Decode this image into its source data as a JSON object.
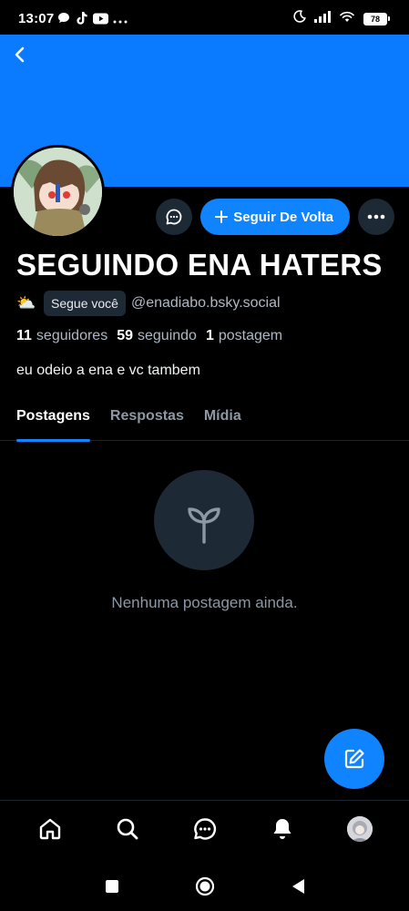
{
  "status_bar": {
    "time": "13:07",
    "battery": "78",
    "left_icons": [
      "chat-bubble-icon",
      "tiktok-icon",
      "youtube-icon",
      "more-dots-icon"
    ],
    "right_icons": [
      "moon-icon",
      "signal-icon",
      "wifi-icon",
      "battery-icon"
    ]
  },
  "profile": {
    "display_name": "SEGUINDO ENA HATERS",
    "handle": "@enadiabo.bsky.social",
    "follows_you_badge": "Segue você",
    "emoji": "⛅",
    "bio": "eu odeio a ena e vc tambem",
    "stats": {
      "followers_count": "11",
      "followers_label": "seguidores",
      "following_count": "59",
      "following_label": "seguindo",
      "posts_count": "1",
      "posts_label": "postagem"
    },
    "banner_color": "#0a7aff"
  },
  "actions": {
    "follow_back_label": "Seguir De Volta",
    "message_icon": "message-icon",
    "more_icon": "more-horizontal-icon"
  },
  "tabs": [
    {
      "label": "Postagens",
      "active": true
    },
    {
      "label": "Respostas",
      "active": false
    },
    {
      "label": "Mídia",
      "active": false
    }
  ],
  "empty_state": {
    "icon": "sprout-icon",
    "text": "Nenhuma postagem ainda."
  },
  "fab": {
    "icon": "compose-icon"
  },
  "bottom_nav": [
    {
      "name": "home",
      "icon": "home-icon"
    },
    {
      "name": "search",
      "icon": "search-icon"
    },
    {
      "name": "chat",
      "icon": "chat-icon"
    },
    {
      "name": "notifications",
      "icon": "bell-icon"
    },
    {
      "name": "profile",
      "icon": "avatar"
    }
  ],
  "colors": {
    "accent": "#1083fe",
    "background": "#000000",
    "muted_text": "#8d98a5",
    "surface": "#1e2936"
  }
}
